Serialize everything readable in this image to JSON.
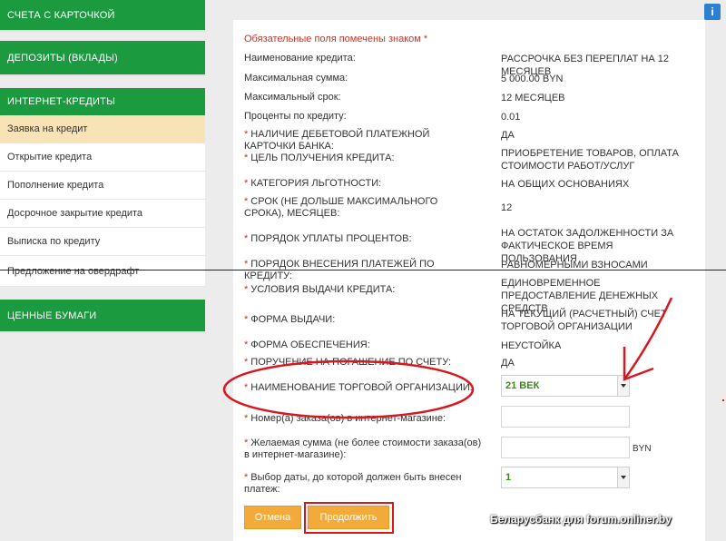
{
  "sidebar": {
    "sections": [
      {
        "label": "СЧЕТА С КАРТОЧКОЙ"
      },
      {
        "label": "ДЕПОЗИТЫ (ВКЛАДЫ)"
      },
      {
        "label": "ИНТЕРНЕТ-КРЕДИТЫ"
      },
      {
        "label": "ЦЕННЫЕ БУМАГИ"
      }
    ],
    "items": [
      {
        "label": "Заявка на кредит",
        "active": true
      },
      {
        "label": "Открытие кредита"
      },
      {
        "label": "Пополнение кредита"
      },
      {
        "label": "Досрочное закрытие кредита"
      },
      {
        "label": "Выписка по кредиту"
      },
      {
        "label": "Предложение на овердрафт"
      }
    ]
  },
  "form": {
    "info_icon": "i",
    "required_note": "Обязательные поля помечены знаком *",
    "star": "*",
    "rows": [
      {
        "label": "Наименование кредита:",
        "value": "РАССРОЧКА БЕЗ ПЕРЕПЛАТ НА 12 МЕСЯЦЕВ"
      },
      {
        "label": "Максимальная сумма:",
        "value": "5 000.00 BYN"
      },
      {
        "label": "Максимальный срок:",
        "value": "12 МЕСЯЦЕВ"
      },
      {
        "label": "Проценты по кредиту:",
        "value": "0.01"
      },
      {
        "label": "НАЛИЧИЕ ДЕБЕТОВОЙ ПЛАТЕЖНОЙ КАРТОЧКИ БАНКА:",
        "value": "ДА"
      },
      {
        "label": "ЦЕЛЬ ПОЛУЧЕНИЯ КРЕДИТА:",
        "value": "ПРИОБРЕТЕНИЕ ТОВАРОВ, ОПЛАТА СТОИМОСТИ РАБОТ/УСЛУГ"
      },
      {
        "label": "КАТЕГОРИЯ ЛЬГОТНОСТИ:",
        "value": "НА ОБЩИХ ОСНОВАНИЯХ"
      },
      {
        "label": "СРОК (НЕ ДОЛЬШЕ МАКСИМАЛЬНОГО СРОКА), МЕСЯЦЕВ:",
        "value": "12"
      },
      {
        "label": "ПОРЯДОК УПЛАТЫ ПРОЦЕНТОВ:",
        "value": "НА ОСТАТОК ЗАДОЛЖЕННОСТИ ЗА ФАКТИЧЕСКОЕ ВРЕМЯ ПОЛЬЗОВАНИЯ"
      },
      {
        "label": "ПОРЯДОК ВНЕСЕНИЯ ПЛАТЕЖЕЙ ПО КРЕДИТУ:",
        "value": "РАВНОМЕРНЫМИ ВЗНОСАМИ"
      },
      {
        "label": "УСЛОВИЯ ВЫДАЧИ КРЕДИТА:",
        "value": "ЕДИНОВРЕМЕННОЕ ПРЕДОСТАВЛЕНИЕ ДЕНЕЖНЫХ СРЕДСТВ"
      },
      {
        "label": "ФОРМА ВЫДАЧИ:",
        "value": "НА ТЕКУЩИЙ (РАСЧЕТНЫЙ) СЧЕТ ТОРГОВОЙ ОРГАНИЗАЦИИ"
      },
      {
        "label": "ФОРМА ОБЕСПЕЧЕНИЯ:",
        "value": "НЕУСТОЙКА"
      },
      {
        "label": "ПОРУЧЕНИЕ НА ПОГАШЕНИЕ ПО СЧЕТУ:",
        "value": "ДА"
      }
    ],
    "merchant_label": "НАИМЕНОВАНИЕ ТОРГОВОЙ ОРГАНИЗАЦИИ:",
    "merchant_value": "21 ВЕК",
    "order_label": "Номер(а) заказа(ов) в интернет-магазине:",
    "amount_label": "Желаемая сумма (не более стоимости заказа(ов) в интернет-магазине):",
    "amount_currency": "BYN",
    "date_label": "Выбор даты, до которой должен быть внесен платеж:",
    "date_value": "1",
    "cancel_label": "Отмена",
    "continue_label": "Продолжить"
  },
  "watermark": "Беларусбанк для forum.onliner.by",
  "colors": {
    "green": "#1c9a3f",
    "orange": "#f2ab3a",
    "red": "#d8171f",
    "active_item": "#f7e3b5"
  }
}
